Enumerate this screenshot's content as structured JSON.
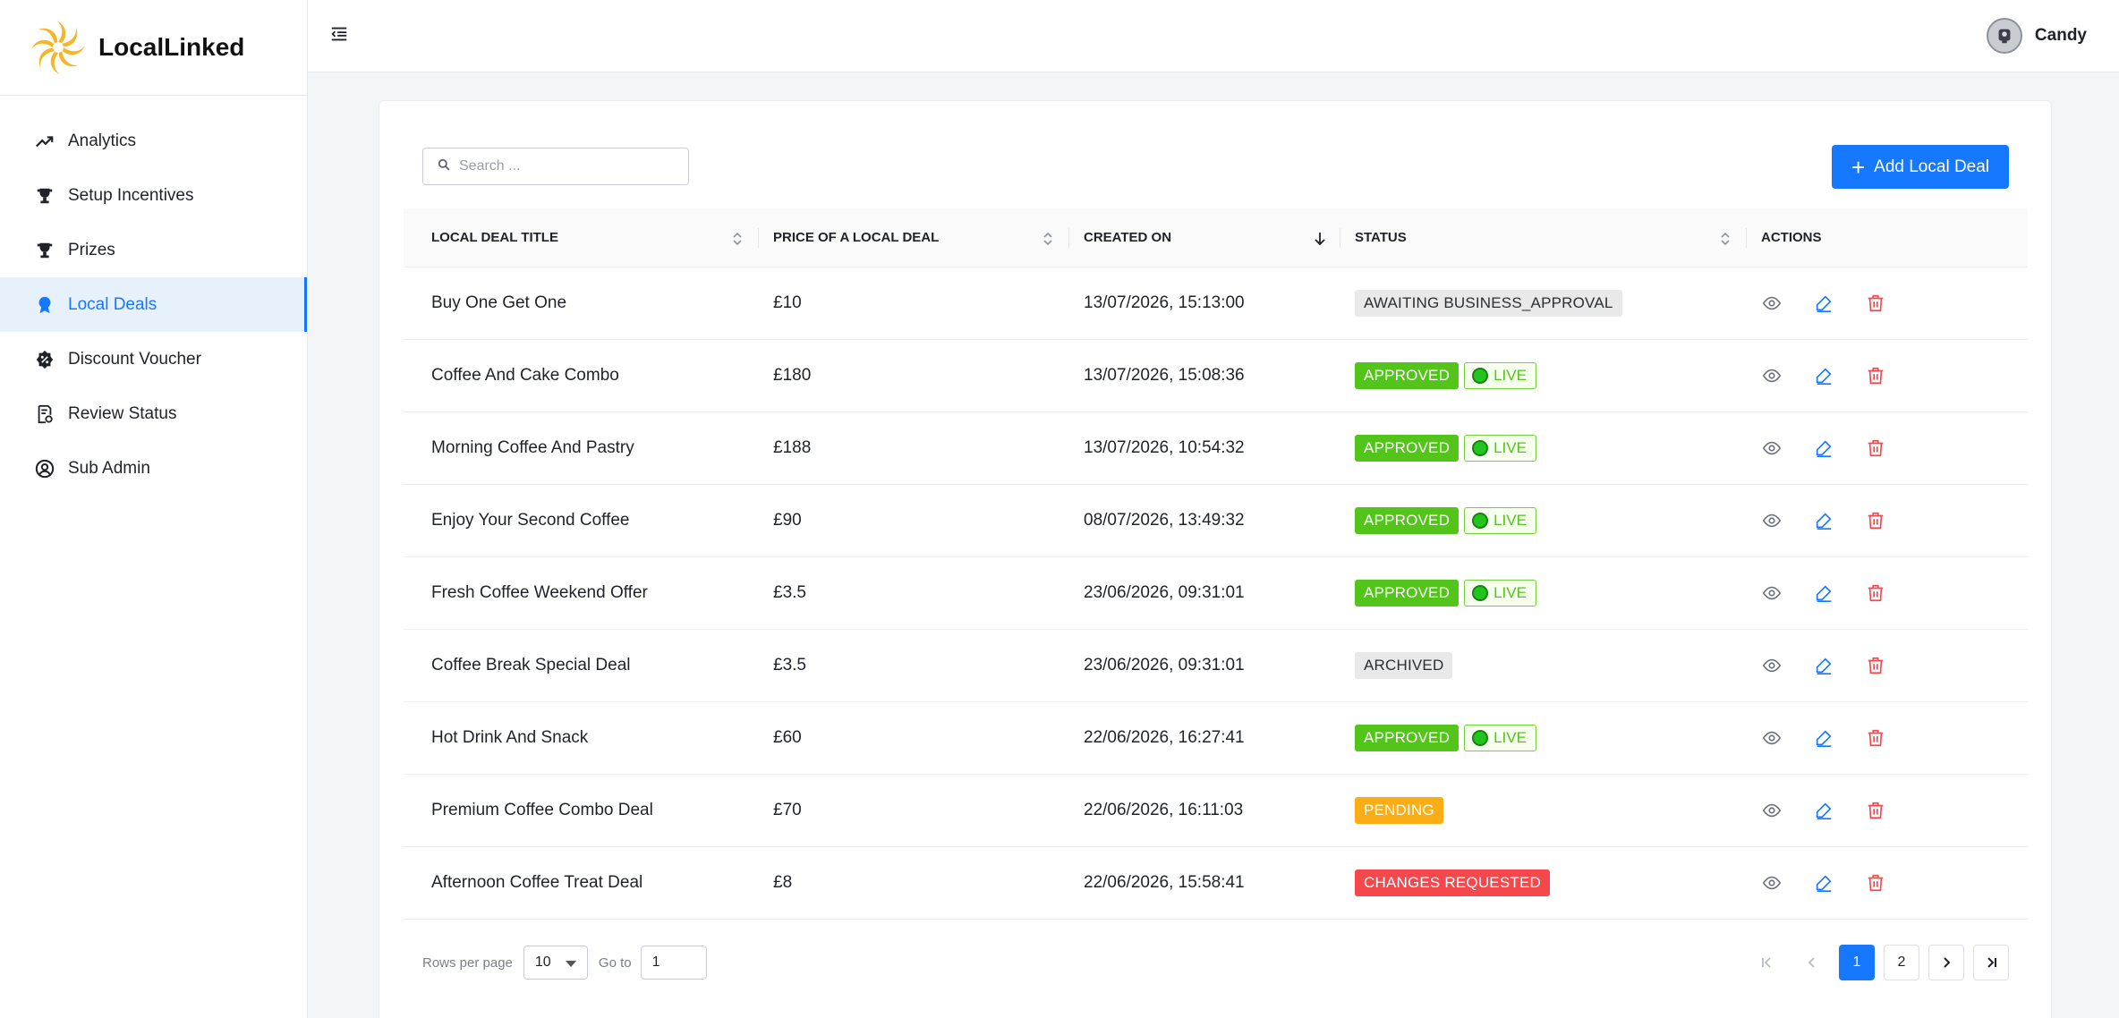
{
  "app": {
    "name": "LocalLinked"
  },
  "user": {
    "name": "Candy"
  },
  "colors": {
    "accent": "#1677ff",
    "approved": "#52c41a",
    "pending": "#faad14",
    "changes_requested": "#f5484d",
    "logo": "#f6b526"
  },
  "sidebar": {
    "items": [
      {
        "label": "Analytics",
        "icon": "trending-up-icon"
      },
      {
        "label": "Setup Incentives",
        "icon": "trophy-icon"
      },
      {
        "label": "Prizes",
        "icon": "trophy-icon"
      },
      {
        "label": "Local Deals",
        "icon": "award-badge-icon",
        "active": true
      },
      {
        "label": "Discount Voucher",
        "icon": "discount-badge-icon"
      },
      {
        "label": "Review Status",
        "icon": "document-check-icon"
      },
      {
        "label": "Sub Admin",
        "icon": "user-circle-icon"
      }
    ]
  },
  "toolbar": {
    "search_placeholder": "Search ...",
    "add_label": "Add Local Deal"
  },
  "table": {
    "columns": [
      "LOCAL DEAL TITLE",
      "PRICE OF A LOCAL DEAL",
      "CREATED ON",
      "STATUS",
      "ACTIONS"
    ],
    "sorted_column": "CREATED ON",
    "sort_direction": "descending",
    "live_label": "LIVE",
    "rows": [
      {
        "title": "Buy One Get One",
        "price": "£10",
        "created": "13/07/2026, 15:13:00",
        "status": "AWAITING BUSINESS_APPROVAL",
        "status_type": "grey",
        "live": false
      },
      {
        "title": "Coffee And Cake Combo",
        "price": "£180",
        "created": "13/07/2026, 15:08:36",
        "status": "APPROVED",
        "status_type": "green",
        "live": true
      },
      {
        "title": "Morning Coffee And Pastry",
        "price": "£188",
        "created": "13/07/2026, 10:54:32",
        "status": "APPROVED",
        "status_type": "green",
        "live": true
      },
      {
        "title": "Enjoy Your Second Coffee",
        "price": "£90",
        "created": "08/07/2026, 13:49:32",
        "status": "APPROVED",
        "status_type": "green",
        "live": true
      },
      {
        "title": "Fresh Coffee Weekend Offer",
        "price": "£3.5",
        "created": "23/06/2026, 09:31:01",
        "status": "APPROVED",
        "status_type": "green",
        "live": true
      },
      {
        "title": "Coffee Break Special Deal",
        "price": "£3.5",
        "created": "23/06/2026, 09:31:01",
        "status": "ARCHIVED",
        "status_type": "grey",
        "live": false
      },
      {
        "title": "Hot Drink And Snack",
        "price": "£60",
        "created": "22/06/2026, 16:27:41",
        "status": "APPROVED",
        "status_type": "green",
        "live": true
      },
      {
        "title": "Premium Coffee Combo Deal",
        "price": "£70",
        "created": "22/06/2026, 16:11:03",
        "status": "PENDING",
        "status_type": "orange",
        "live": false
      },
      {
        "title": "Afternoon Coffee Treat Deal",
        "price": "£8",
        "created": "22/06/2026, 15:58:41",
        "status": "CHANGES REQUESTED",
        "status_type": "red",
        "live": false
      }
    ]
  },
  "pagination": {
    "rows_per_page_label": "Rows per page",
    "rows_per_page": "10",
    "goto_label": "Go to",
    "goto_value": "1",
    "pages": [
      "1",
      "2"
    ],
    "current_page": "1"
  }
}
